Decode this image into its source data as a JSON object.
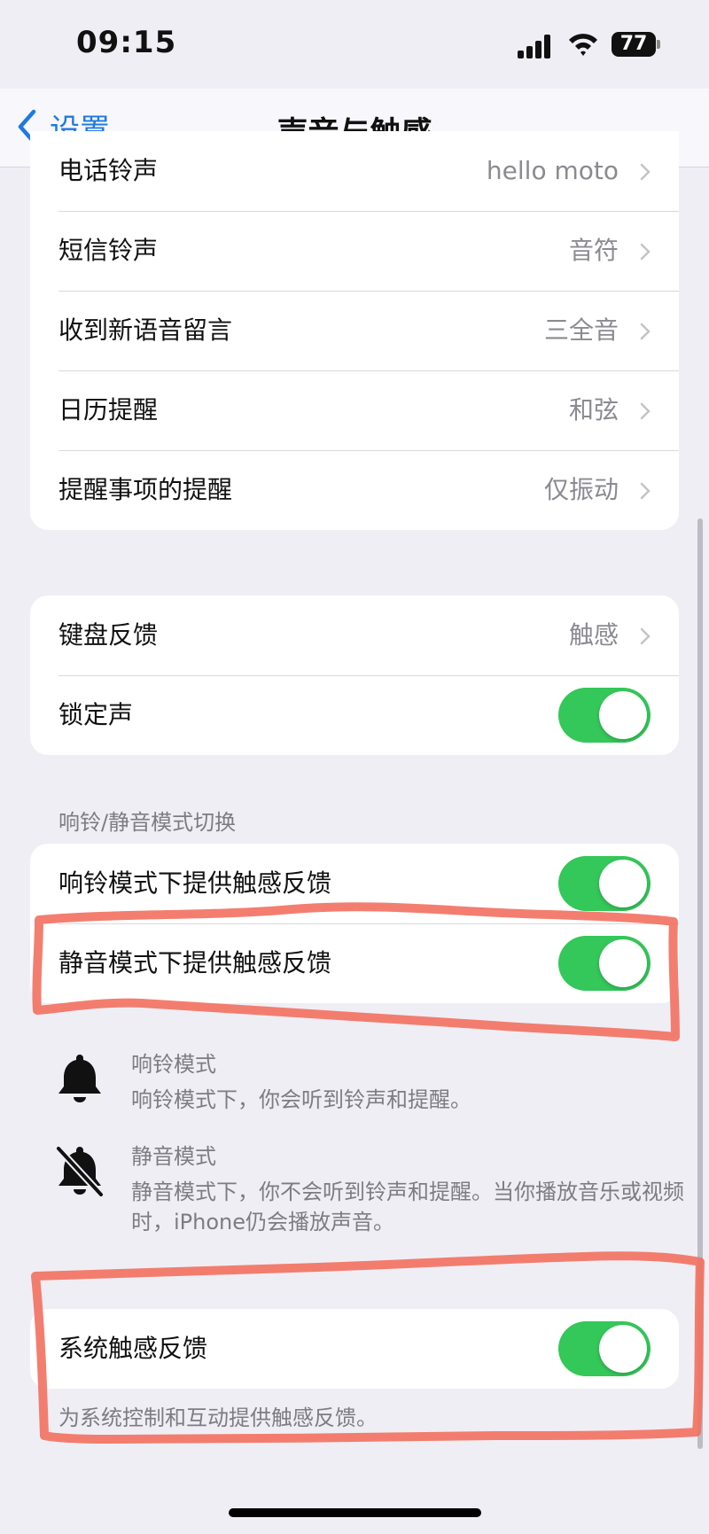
{
  "status_bar": {
    "time": "09:15",
    "battery": "77"
  },
  "nav": {
    "back_label": "设置",
    "title": "声音与触感"
  },
  "ringtone_group": [
    {
      "label": "电话铃声",
      "value": "hello moto"
    },
    {
      "label": "短信铃声",
      "value": "音符"
    },
    {
      "label": "收到新语音留言",
      "value": "三全音"
    },
    {
      "label": "日历提醒",
      "value": "和弦"
    },
    {
      "label": "提醒事项的提醒",
      "value": "仅振动"
    }
  ],
  "keyboard_group": {
    "keyboard_feedback": {
      "label": "键盘反馈",
      "value": "触感"
    },
    "lock_sound": {
      "label": "锁定声",
      "on": true
    }
  },
  "ring_silent": {
    "header": "响铃/静音模式切换",
    "ring_haptics": {
      "label": "响铃模式下提供触感反馈",
      "on": true
    },
    "silent_haptics": {
      "label": "静音模式下提供触感反馈",
      "on": true
    }
  },
  "mode_info": {
    "ring": {
      "title": "响铃模式",
      "desc": "响铃模式下，你会听到铃声和提醒。"
    },
    "silent": {
      "title": "静音模式",
      "desc": "静音模式下，你不会听到铃声和提醒。当你播放音乐或视频时，iPhone仍会播放声音。"
    }
  },
  "system_haptics": {
    "label": "系统触感反馈",
    "on": true,
    "footnote": "为系统控制和互动提供触感反馈。"
  },
  "colors": {
    "accent": "#1f7ae0",
    "toggle_on": "#34c759",
    "annotation": "#f2705f"
  }
}
